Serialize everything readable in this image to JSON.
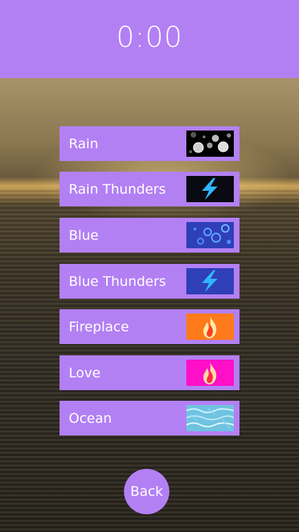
{
  "timer": {
    "value": "0:00"
  },
  "sounds": [
    {
      "label": "Rain",
      "icon": "rain-drops-icon",
      "thumb_bg": "#000000"
    },
    {
      "label": "Rain Thunders",
      "icon": "lightning-bolt-icon",
      "thumb_bg": "#0a0a12"
    },
    {
      "label": "Blue",
      "icon": "blue-bubbles-icon",
      "thumb_bg": "#2f3fb8"
    },
    {
      "label": "Blue Thunders",
      "icon": "lightning-bolt-icon",
      "thumb_bg": "#2f3fb8"
    },
    {
      "label": "Fireplace",
      "icon": "flame-icon",
      "thumb_bg": "#ff7a1a"
    },
    {
      "label": "Love",
      "icon": "flame-icon",
      "thumb_bg": "#ff10c8"
    },
    {
      "label": "Ocean",
      "icon": "water-texture-icon",
      "thumb_bg": "#5fb6d9"
    }
  ],
  "back_button": {
    "label": "Back"
  },
  "colors": {
    "accent": "#b380f4",
    "text": "#ffffff"
  }
}
